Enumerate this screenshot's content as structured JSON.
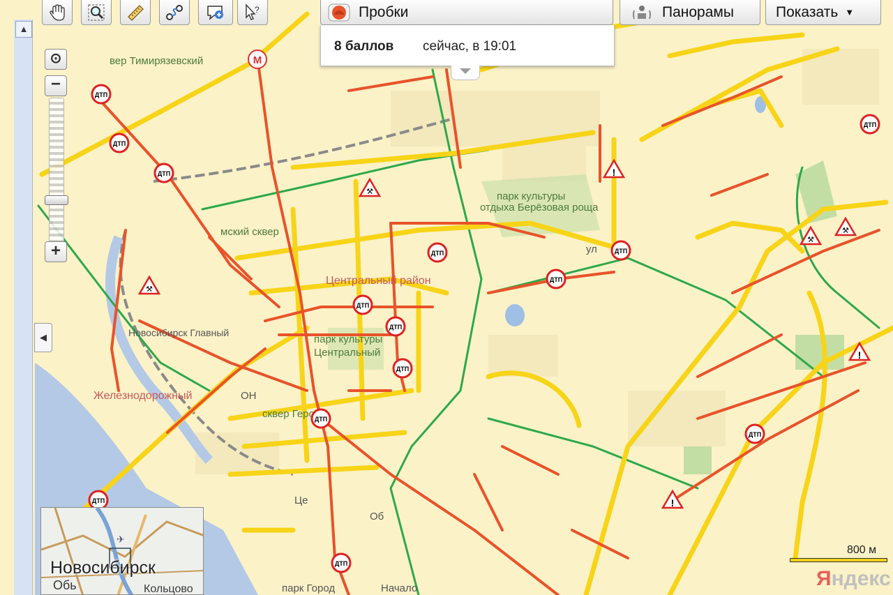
{
  "toolbar": {
    "tools": [
      {
        "name": "hand-tool",
        "icon": "hand-icon"
      },
      {
        "name": "zoom-area-tool",
        "icon": "magnifier-icon"
      },
      {
        "name": "ruler-tool",
        "icon": "ruler-icon"
      },
      {
        "name": "route-tool",
        "icon": "route-icon"
      },
      {
        "name": "add-object-tool",
        "icon": "add-comment-icon"
      },
      {
        "name": "help-tool",
        "icon": "cursor-help-icon"
      }
    ],
    "traffic_label": "Пробки",
    "panoramas_label": "Панорамы",
    "show_label": "Показать"
  },
  "traffic_popup": {
    "score": "8 баллов",
    "time": "сейчас, в 19:01"
  },
  "map_labels": {
    "timiryazevsky": "вер Тимирязевский",
    "sovetsky": "мский сквер",
    "central_district": "Центральный район",
    "park_kultury": "парк культуры",
    "park_bereza": "отдыха Берёзовая роща",
    "glavny": "Новосибирск Главный",
    "zheleznodorozhny": "Железнодорожный",
    "park_culture2": "парк культуры",
    "central_park": "Центральный",
    "square_geroev": "сквер Героев",
    "tsentr": "Це",
    "park_gorod": "парк Город",
    "nachalo": "Начало",
    "ob": "Об",
    "ul": "ул",
    "na": "ОН"
  },
  "markers": {
    "accident": "ДТП",
    "metro": "М"
  },
  "minimap": {
    "city": "Новосибирск",
    "sub1": "Обь",
    "sub2": "Кольцово"
  },
  "scale": "800 м",
  "logo": {
    "first": "Я",
    "rest": "ндекс"
  },
  "colors": {
    "map_bg": "#fbf2c8",
    "traffic_red": "#e8532a",
    "traffic_yellow": "#f7d417",
    "traffic_green": "#2da84a",
    "water": "#b4c9e6",
    "park": "#c3dea5"
  }
}
